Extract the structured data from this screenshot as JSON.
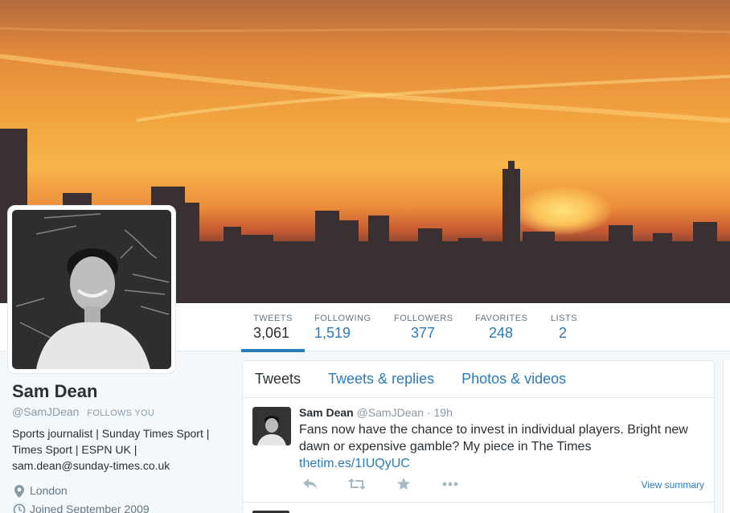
{
  "profile": {
    "name": "Sam Dean",
    "handle": "@SamJDean",
    "follows_you": "FOLLOWS YOU",
    "bio": "Sports journalist | Sunday Times Sport | Times Sport | ESPN UK | sam.dean@sunday-times.co.uk",
    "location": "London",
    "joined": "Joined September 2009"
  },
  "stats": [
    {
      "label": "TWEETS",
      "value": "3,061"
    },
    {
      "label": "FOLLOWING",
      "value": "1,519"
    },
    {
      "label": "FOLLOWERS",
      "value": "377"
    },
    {
      "label": "FAVORITES",
      "value": "248"
    },
    {
      "label": "LISTS",
      "value": "2"
    }
  ],
  "tabs": [
    "Tweets",
    "Tweets & replies",
    "Photos & videos"
  ],
  "tweet": {
    "name": "Sam Dean",
    "handle": "@SamJDean",
    "dot": "·",
    "time": "19h",
    "text": "Fans now have the chance to invest in individual players. Bright new dawn or expensive gamble? My piece in The Times",
    "link": "thetim.es/1IUQyUC",
    "view_summary": "View summary"
  },
  "icons": {
    "location": "map-pin-icon",
    "joined": "calendar-icon",
    "reply": "reply-icon",
    "retweet": "retweet-icon",
    "favorite": "star-icon",
    "more": "more-dots-icon"
  },
  "colors": {
    "link": "#2b7bb9",
    "muted": "#8899a6",
    "text": "#292f33"
  }
}
